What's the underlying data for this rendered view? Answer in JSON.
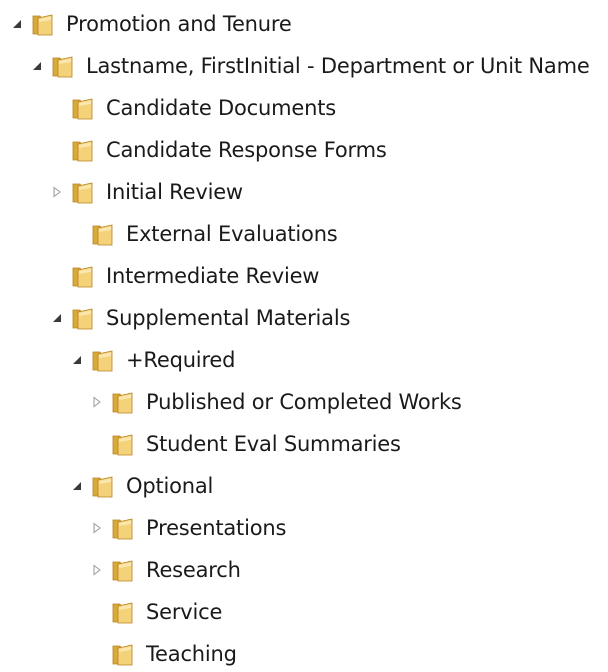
{
  "tree": {
    "nodes": [
      {
        "label": "Promotion and Tenure",
        "state": "expanded",
        "icon": "folder-icon"
      },
      {
        "label": "Lastname, FirstInitial - Department or Unit Name",
        "state": "expanded",
        "icon": "folder-icon"
      },
      {
        "label": "Candidate Documents",
        "state": "leaf",
        "icon": "folder-icon"
      },
      {
        "label": "Candidate Response Forms",
        "state": "leaf",
        "icon": "folder-icon"
      },
      {
        "label": "Initial Review",
        "state": "collapsed",
        "icon": "folder-icon"
      },
      {
        "label": "External Evaluations",
        "state": "leaf",
        "icon": "folder-icon"
      },
      {
        "label": "Intermediate Review",
        "state": "leaf",
        "icon": "folder-icon"
      },
      {
        "label": "Supplemental Materials",
        "state": "expanded",
        "icon": "folder-icon"
      },
      {
        "label": "+Required",
        "state": "expanded",
        "icon": "folder-icon"
      },
      {
        "label": "Published or Completed Works",
        "state": "collapsed",
        "icon": "folder-icon"
      },
      {
        "label": "Student Eval Summaries",
        "state": "leaf",
        "icon": "folder-icon"
      },
      {
        "label": "Optional",
        "state": "expanded",
        "icon": "folder-icon"
      },
      {
        "label": "Presentations",
        "state": "collapsed",
        "icon": "folder-icon"
      },
      {
        "label": "Research",
        "state": "collapsed",
        "icon": "folder-icon"
      },
      {
        "label": "Service",
        "state": "leaf",
        "icon": "folder-icon"
      },
      {
        "label": "Teaching",
        "state": "leaf",
        "icon": "folder-icon"
      }
    ]
  },
  "colors": {
    "folder_back": "#d9a93a",
    "folder_front": "#f4d27a",
    "folder_edge": "#b78320",
    "expander_filled": "#3a3a3a",
    "expander_outline": "#9a9a9a"
  }
}
